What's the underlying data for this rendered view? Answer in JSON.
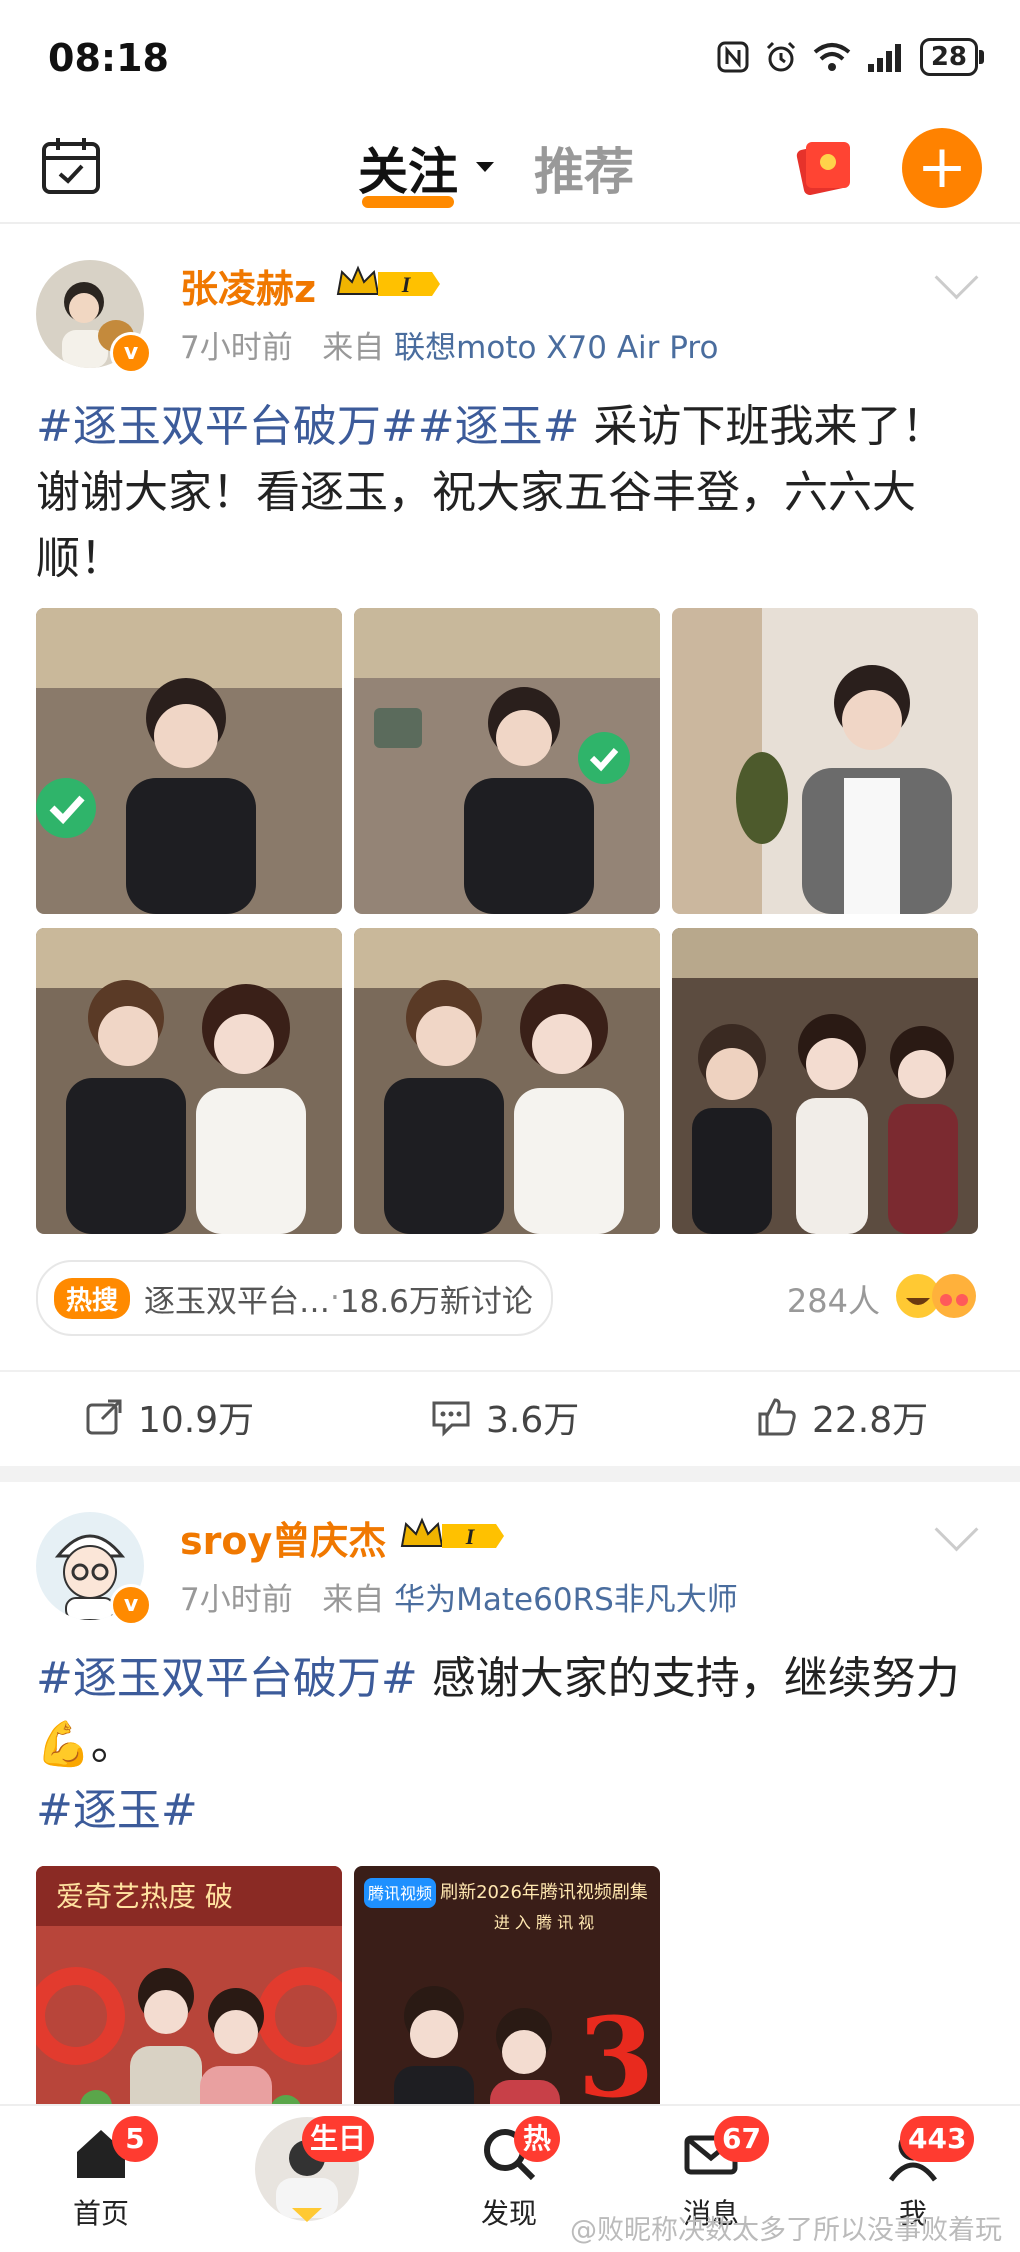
{
  "status": {
    "time": "08:18",
    "battery": "28"
  },
  "nav": {
    "tab_follow": "关注",
    "tab_recommend": "推荐",
    "plus": "+"
  },
  "posts": [
    {
      "username": "张凌赫z",
      "level": "I",
      "time": "7小时前",
      "from": "来自",
      "source": "联想moto X70 Air Pro",
      "topic1": "#逐玉双平台破万#",
      "topic2": "#逐玉#",
      "text": " 采访下班我来了！谢谢大家！看逐玉，祝大家五谷丰登，六六大顺！",
      "hot_tag": "热搜",
      "hot_topic": "逐玉双平台…",
      "hot_dot": " · ",
      "hot_count": "18.6万新讨论",
      "people": "284人",
      "reposts": "10.9万",
      "comments": "3.6万",
      "likes": "22.8万"
    },
    {
      "username": "sroy曾庆杰",
      "level": "I",
      "time": "7小时前",
      "from": "来自",
      "source": "华为Mate60RS非凡大师",
      "topic1": "#逐玉双平台破万#",
      "text": " 感谢大家的支持，继续努力💪。",
      "topic2": "#逐玉#",
      "img1_text": "爱奇艺热度 破",
      "img2_brand": "腾讯视频",
      "img2_text": "刷新2026年腾讯视频剧集",
      "img2_sub": "进 入 腾 讯 视",
      "img2_big": "3"
    }
  ],
  "tabbar": [
    {
      "label": "首页",
      "badge": "5"
    },
    {
      "label": "",
      "badge": "生日"
    },
    {
      "label": "发现",
      "badge": "热"
    },
    {
      "label": "消息",
      "badge": "67"
    },
    {
      "label": "我",
      "badge": "443"
    }
  ],
  "watermark": "@败昵称决数太多了所以没事败着玩"
}
